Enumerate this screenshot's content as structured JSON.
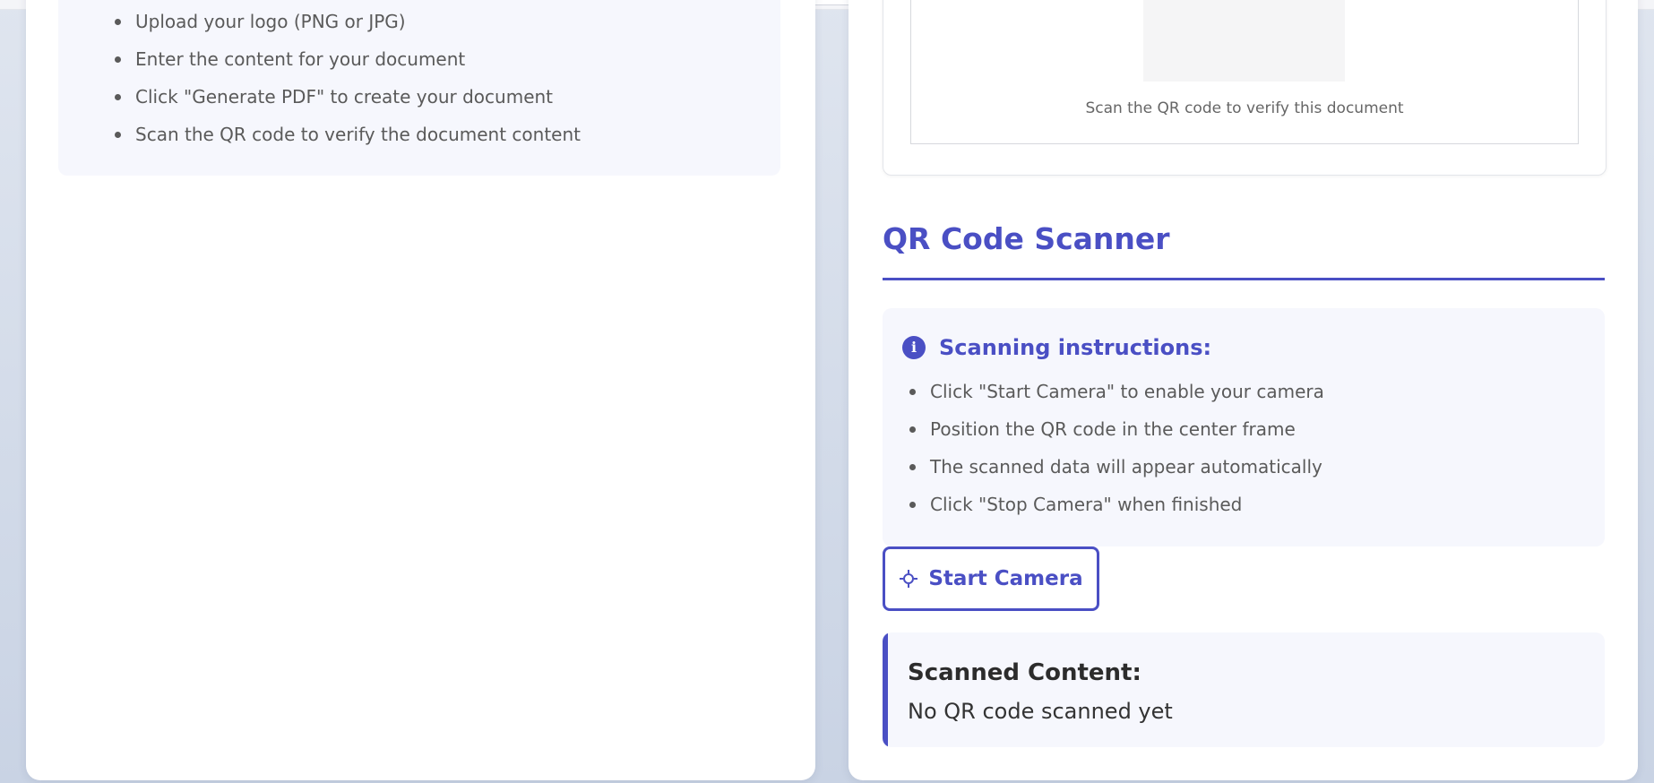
{
  "left_panel": {
    "instructions": [
      "Upload your logo (PNG or JPG)",
      "Enter the content for your document",
      "Click \"Generate PDF\" to create your document",
      "Scan the QR code to verify the document content"
    ]
  },
  "qr_preview": {
    "caption": "Scan the QR code to verify this document"
  },
  "scanner": {
    "title": "QR Code Scanner",
    "instructions_title": "Scanning instructions:",
    "info_icon_glyph": "i",
    "instructions": [
      "Click \"Start Camera\" to enable your camera",
      "Position the QR code in the center frame",
      "The scanned data will appear automatically",
      "Click \"Stop Camera\" when finished"
    ],
    "start_button_label": "Start Camera",
    "start_button_icon": "crosshair-icon",
    "result_title": "Scanned Content:",
    "result_text": "No QR code scanned yet"
  },
  "colors": {
    "accent": "#4a4fc4",
    "box_background": "#f6f7fd",
    "page_background": "#c9d3e4"
  }
}
